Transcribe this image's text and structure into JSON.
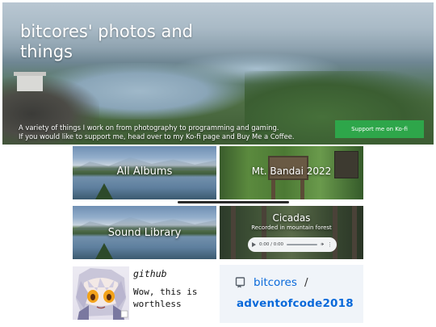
{
  "hero": {
    "title": "bitcores' photos and things",
    "description_line1": "A variety of things I work on from photography to programming and gaming.",
    "description_line2": "If you would like to support me, head over to my Ko-fi page and Buy Me a Coffee.",
    "kofi_button": "Support me on Ko-fi"
  },
  "tiles": {
    "all_albums": "All Albums",
    "mt_bandai": "Mt. Bandai 2022",
    "sound_library": "Sound Library",
    "cicadas": {
      "title": "Cicadas",
      "subtitle": "Recorded in mountain forest",
      "time": "0:00 / 0:00"
    }
  },
  "github_card": {
    "title": "github",
    "description": "Wow, this is worthless"
  },
  "repo_card": {
    "owner": "bitcores",
    "slash": "/",
    "name": "adventofcode2018"
  },
  "colors": {
    "kofi_green": "#2ea64a",
    "link_blue": "#0969da"
  }
}
